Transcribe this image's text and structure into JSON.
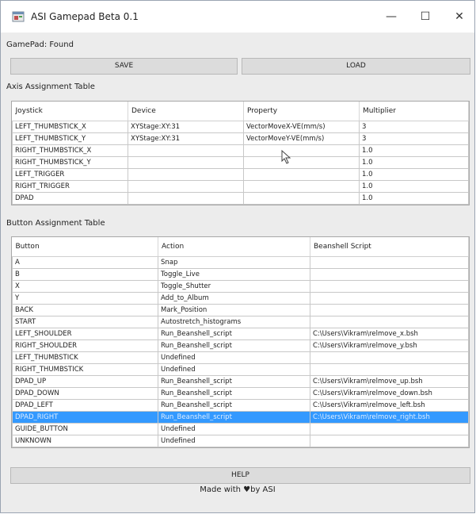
{
  "window": {
    "title": "ASI Gamepad Beta 0.1",
    "minimize_glyph": "—",
    "maximize_glyph": "☐",
    "close_glyph": "✕",
    "icon": "app-window-icon"
  },
  "status": {
    "text": "GamePad: Found"
  },
  "toolbar": {
    "save_label": "SAVE",
    "load_label": "LOAD"
  },
  "axis": {
    "section_title": "Axis Assignment Table",
    "columns": [
      "Joystick",
      "Device",
      "Property",
      "Multiplier"
    ],
    "rows": [
      [
        "LEFT_THUMBSTICK_X",
        "XYStage:XY:31",
        "VectorMoveX-VE(mm/s)",
        "3"
      ],
      [
        "LEFT_THUMBSTICK_Y",
        "XYStage:XY:31",
        "VectorMoveY-VE(mm/s)",
        "3"
      ],
      [
        "RIGHT_THUMBSTICK_X",
        "",
        "",
        "1.0"
      ],
      [
        "RIGHT_THUMBSTICK_Y",
        "",
        "",
        "1.0"
      ],
      [
        "LEFT_TRIGGER",
        "",
        "",
        "1.0"
      ],
      [
        "RIGHT_TRIGGER",
        "",
        "",
        "1.0"
      ],
      [
        "DPAD",
        "",
        "",
        "1.0"
      ]
    ]
  },
  "buttons": {
    "section_title": "Button Assignment Table",
    "columns": [
      "Button",
      "Action",
      "Beanshell Script"
    ],
    "rows": [
      [
        "A",
        "Snap",
        ""
      ],
      [
        "B",
        "Toggle_Live",
        ""
      ],
      [
        "X",
        "Toggle_Shutter",
        ""
      ],
      [
        "Y",
        "Add_to_Album",
        ""
      ],
      [
        "BACK",
        "Mark_Position",
        ""
      ],
      [
        "START",
        "Autostretch_histograms",
        ""
      ],
      [
        "LEFT_SHOULDER",
        "Run_Beanshell_script",
        "C:\\Users\\Vikram\\relmove_x.bsh"
      ],
      [
        "RIGHT_SHOULDER",
        "Run_Beanshell_script",
        "C:\\Users\\Vikram\\relmove_y.bsh"
      ],
      [
        "LEFT_THUMBSTICK",
        "Undefined",
        ""
      ],
      [
        "RIGHT_THUMBSTICK",
        "Undefined",
        ""
      ],
      [
        "DPAD_UP",
        "Run_Beanshell_script",
        "C:\\Users\\Vikram\\relmove_up.bsh"
      ],
      [
        "DPAD_DOWN",
        "Run_Beanshell_script",
        "C:\\Users\\Vikram\\relmove_down.bsh"
      ],
      [
        "DPAD_LEFT",
        "Run_Beanshell_script",
        "C:\\Users\\Vikram\\relmove_left.bsh"
      ],
      [
        "DPAD_RIGHT",
        "Run_Beanshell_script",
        "C:\\Users\\Vikram\\relmove_right.bsh"
      ],
      [
        "GUIDE_BUTTON",
        "Undefined",
        ""
      ],
      [
        "UNKNOWN",
        "Undefined",
        ""
      ]
    ],
    "selected_row": 13
  },
  "help": {
    "label": "HELP"
  },
  "footer": {
    "prefix": "Made with",
    "heart": "♥",
    "suffix": "by ASI"
  },
  "colors": {
    "selection": "#3399ff",
    "window_bg": "#ececec"
  }
}
